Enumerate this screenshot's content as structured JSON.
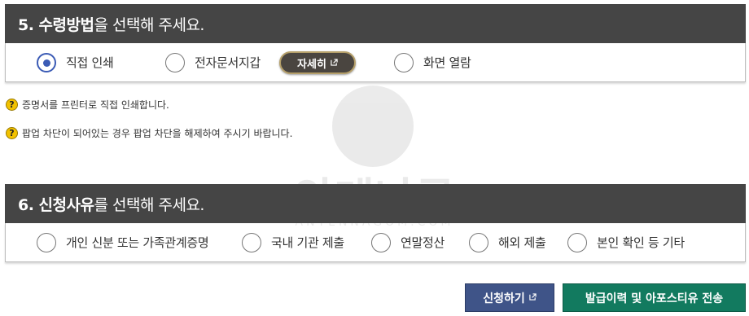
{
  "section5": {
    "header_bold": "5. 수령방법",
    "header_rest": "을 선택해 주세요.",
    "options": [
      {
        "label": "직접 인쇄",
        "checked": true
      },
      {
        "label": "전자문서지갑",
        "checked": false
      },
      {
        "label": "화면 열람",
        "checked": false
      }
    ],
    "detail_button": "자세히"
  },
  "notices": [
    "증명서를 프린터로 직접 인쇄합니다.",
    "팝업 차단이 되어있는 경우 팝업 차단을 해제하여 주시기 바랍니다."
  ],
  "watermark": {
    "main": "안테나곰",
    "sub": "ANTENNAGOM.COM"
  },
  "section6": {
    "header_bold": "6. 신청사유",
    "header_rest": "를 선택해 주세요.",
    "options": [
      {
        "label": "개인 신분 또는 가족관계증명",
        "checked": false
      },
      {
        "label": "국내 기관 제출",
        "checked": false
      },
      {
        "label": "연말정산",
        "checked": false
      },
      {
        "label": "해외 제출",
        "checked": false
      },
      {
        "label": "본인 확인 등 기타",
        "checked": false
      }
    ]
  },
  "buttons": {
    "apply": "신청하기",
    "send": "발급이력 및 아포스티유 전송"
  },
  "colors": {
    "header_bg": "#454545",
    "radio_accent": "#3b5bb5",
    "apply_button": "#3f5488",
    "send_button": "#127a5f",
    "notice_icon": "#f2c200"
  },
  "icons": {
    "notice": "question-circle-icon",
    "external": "external-link-icon"
  }
}
